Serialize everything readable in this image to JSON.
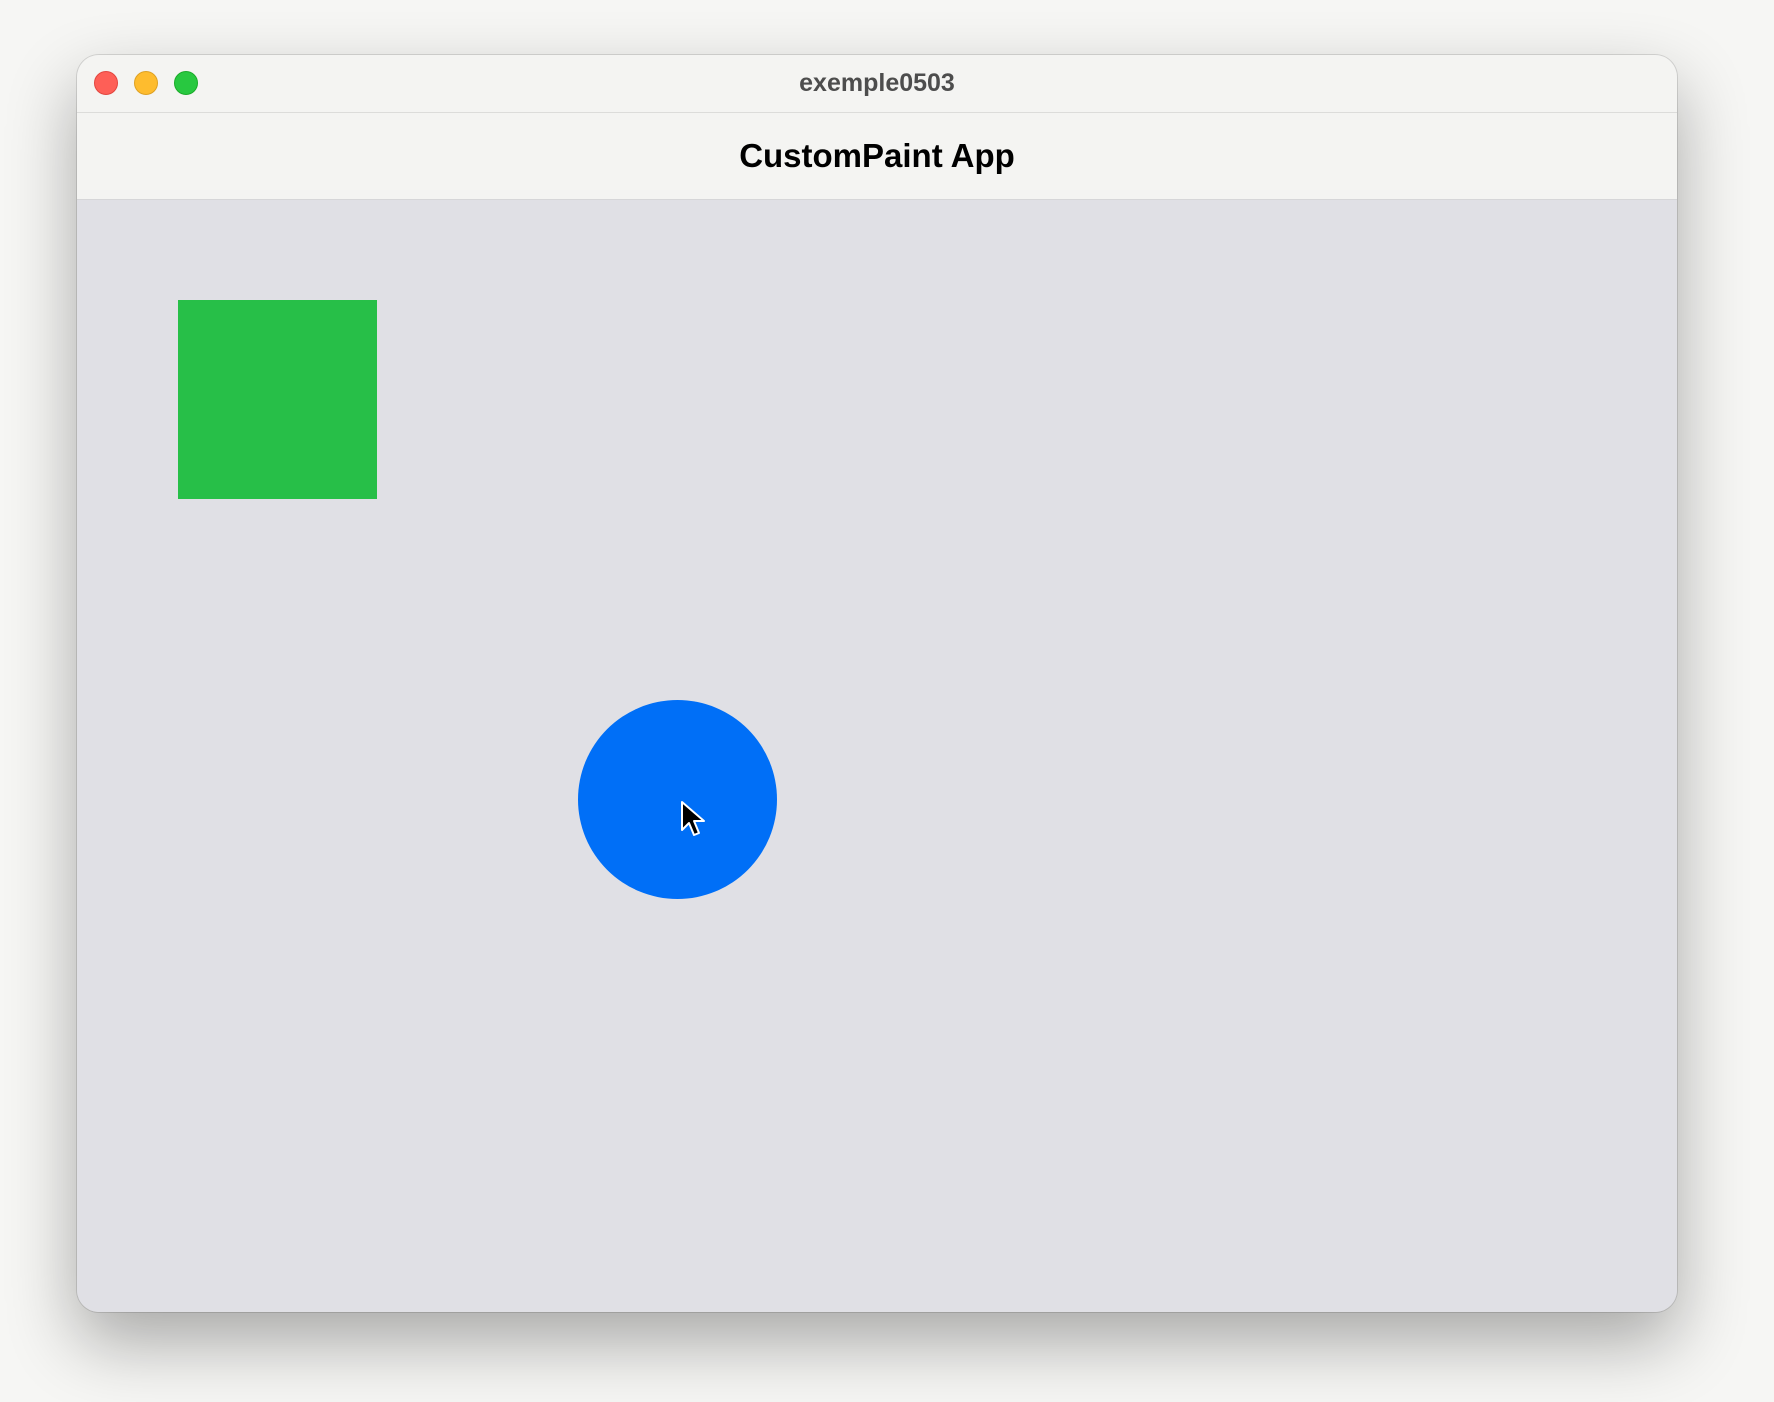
{
  "window": {
    "title": "exemple0503"
  },
  "appbar": {
    "title": "CustomPaint App"
  },
  "canvas": {
    "background": "#e0e0e5",
    "shapes": [
      {
        "kind": "square",
        "color": "#27bf48"
      },
      {
        "kind": "circle",
        "color": "#006ff7"
      }
    ]
  },
  "icons": {
    "close": "close-icon",
    "minimize": "minimize-icon",
    "maximize": "maximize-icon",
    "cursor": "mouse-pointer-icon"
  }
}
